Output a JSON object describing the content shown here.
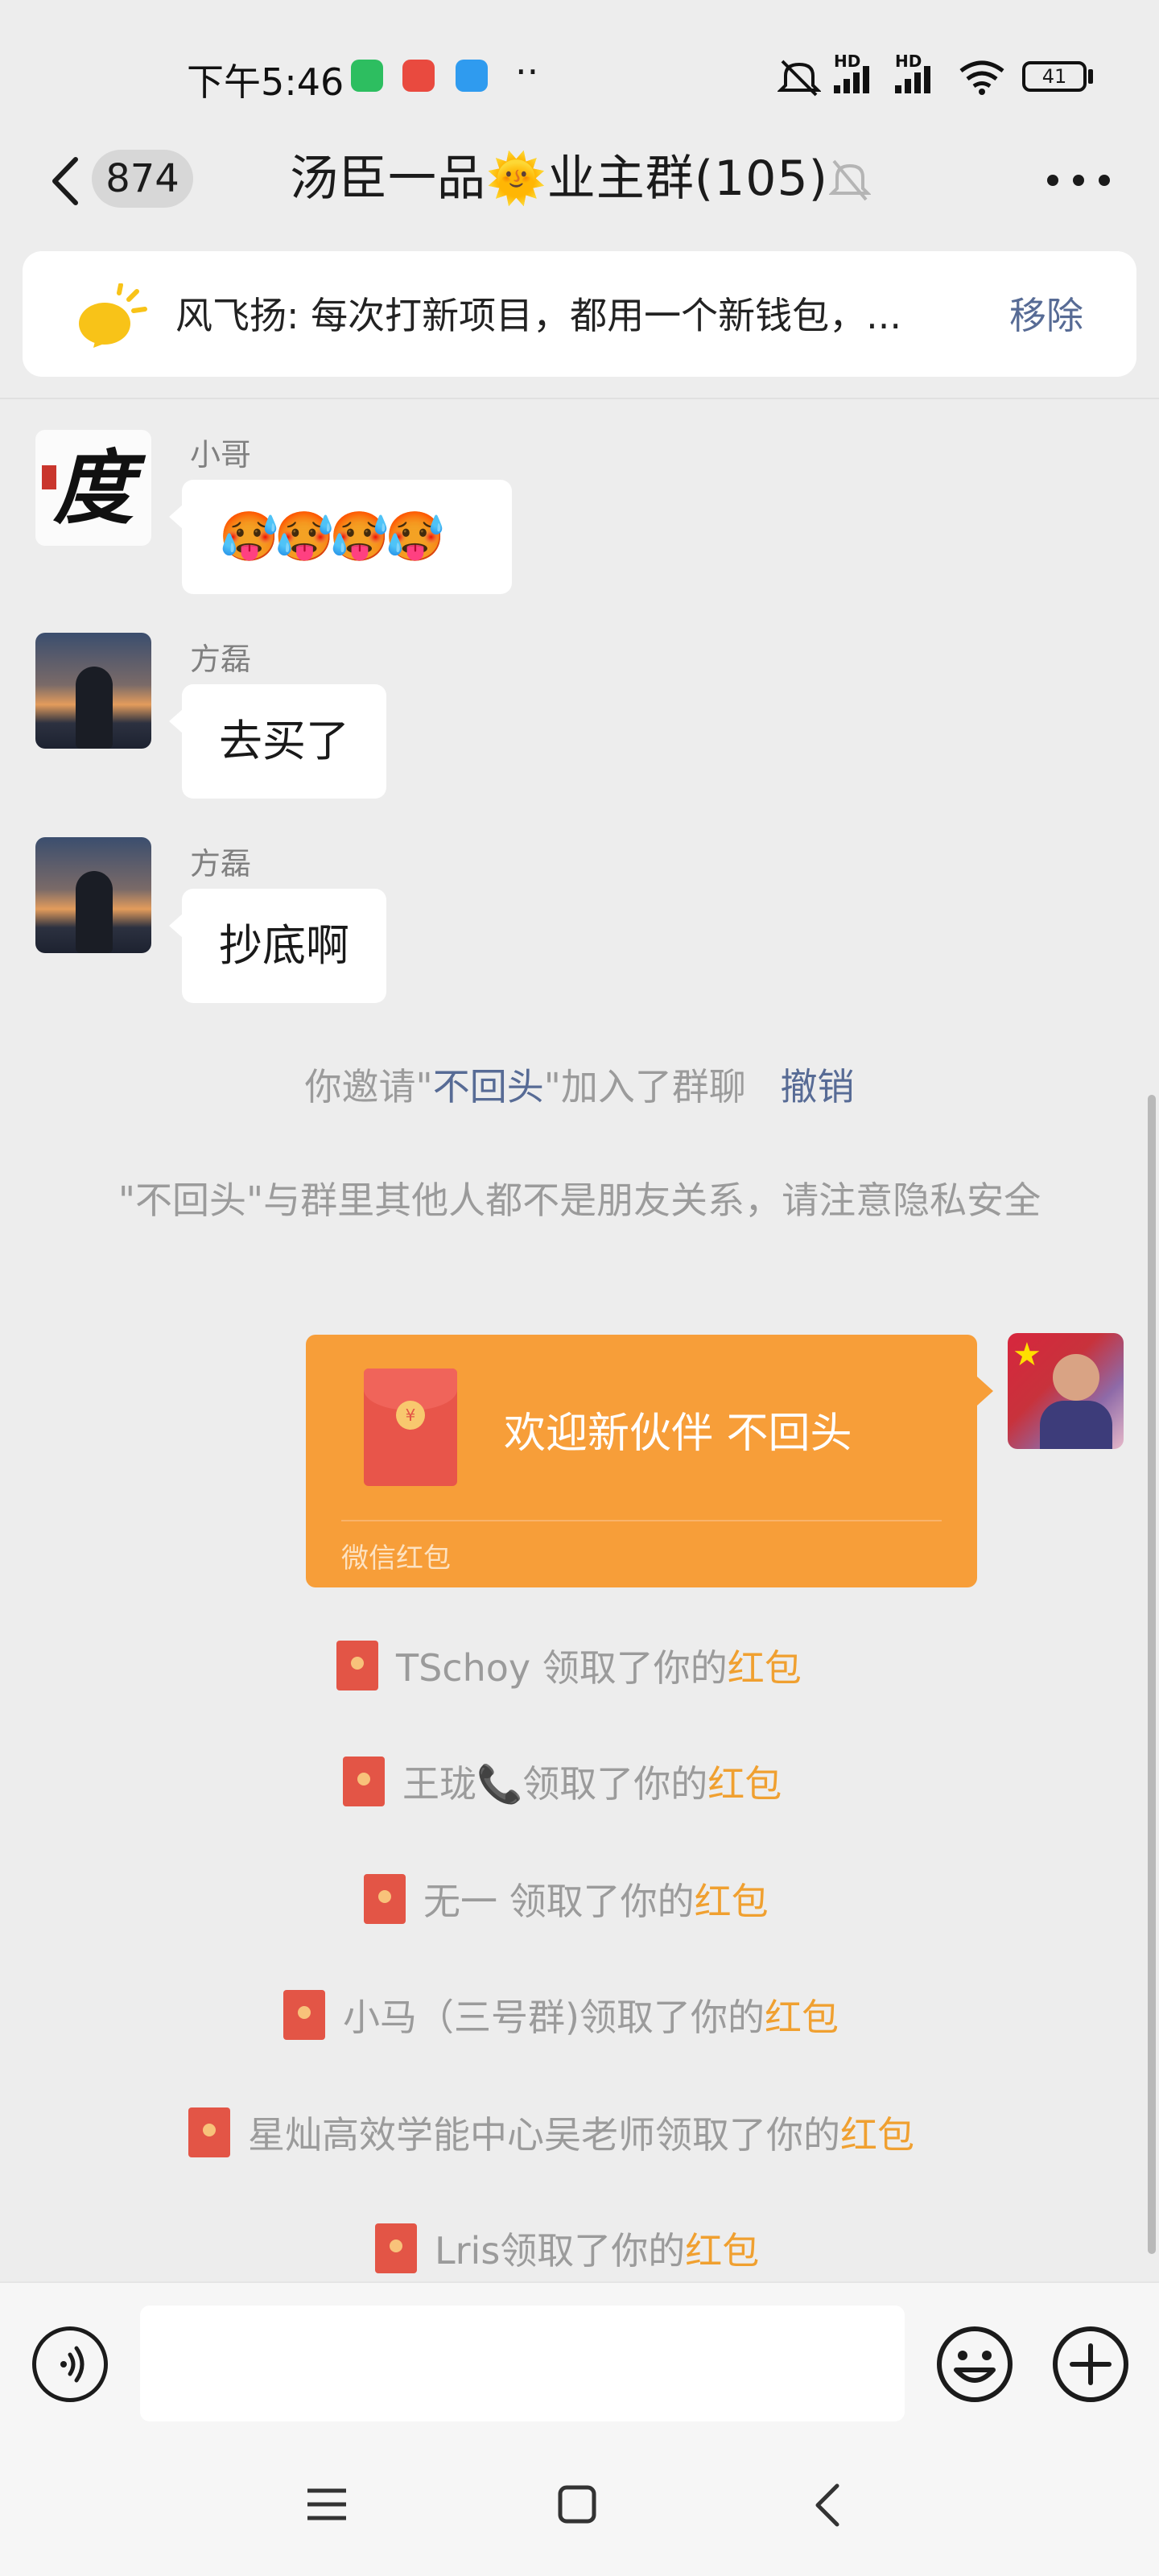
{
  "status_bar": {
    "time": "下午5:46",
    "dots": "··",
    "network_1": "HD",
    "network_2": "HD",
    "battery": "41"
  },
  "header": {
    "unread_count": "874",
    "title": "汤臣一品🌞业主群(105)"
  },
  "pinned": {
    "text": "风飞扬: 每次打新项目，都用一个新钱包，...",
    "remove_label": "移除"
  },
  "messages": [
    {
      "sender": "小哥",
      "content": "🥵🥵🥵🥵"
    },
    {
      "sender": "方磊",
      "content": "去买了"
    },
    {
      "sender": "方磊",
      "content": "抄底啊"
    }
  ],
  "system": {
    "invite_prefix": "你邀请\"",
    "invite_name": "不回头",
    "invite_suffix": "\"加入了群聊",
    "revoke_label": "撤销",
    "privacy_notice": "\"不回头\"与群里其他人都不是朋友关系，请注意隐私安全"
  },
  "red_packet": {
    "greeting": "欢迎新伙伴  不回头",
    "footer": "微信红包",
    "symbol": "¥"
  },
  "claims": [
    {
      "name": "TSchoy 领取了你的",
      "link": "红包"
    },
    {
      "name": "王珑📞领取了你的",
      "link": "红包"
    },
    {
      "name": "无一 领取了你的",
      "link": "红包"
    },
    {
      "name": "小马（三号群)领取了你的",
      "link": "红包"
    },
    {
      "name": "星灿高效学能中心吴老师领取了你的",
      "link": "红包"
    },
    {
      "name": "Lris领取了你的",
      "link": "红包"
    }
  ],
  "avatar_text": {
    "xiaoge": "度"
  },
  "colors": {
    "red_packet": "#f79e39",
    "link_blue": "#576b95",
    "chat_bg": "#ededed"
  }
}
